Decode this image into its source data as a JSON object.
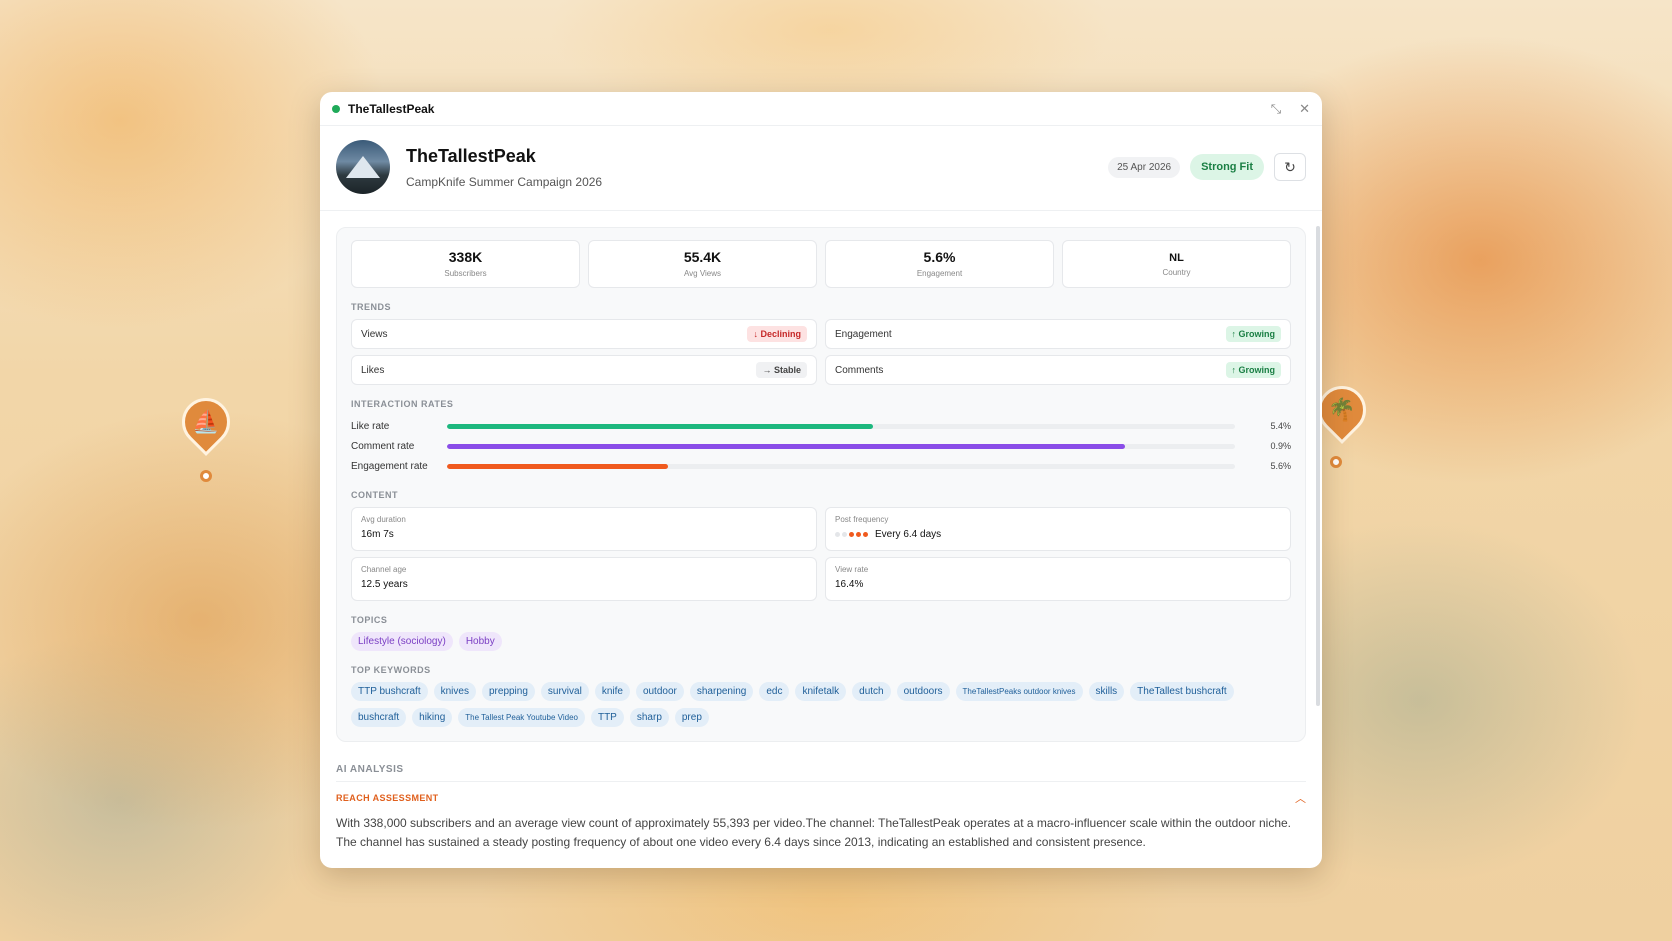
{
  "window": {
    "title": "TheTallestPeak"
  },
  "header": {
    "name": "TheTallestPeak",
    "campaign": "CampKnife Summer Campaign 2026",
    "date": "25 Apr 2026",
    "fit": "Strong Fit"
  },
  "stats": [
    {
      "value": "338K",
      "label": "Subscribers"
    },
    {
      "value": "55.4K",
      "label": "Avg Views"
    },
    {
      "value": "5.6%",
      "label": "Engagement"
    },
    {
      "value": "NL",
      "label": "Country"
    }
  ],
  "trends": {
    "label": "TRENDS",
    "items": [
      {
        "name": "Views",
        "status": "↓ Declining",
        "kind": "decl"
      },
      {
        "name": "Engagement",
        "status": "↑ Growing",
        "kind": "grow"
      },
      {
        "name": "Likes",
        "status": "→ Stable",
        "kind": "stable"
      },
      {
        "name": "Comments",
        "status": "↑ Growing",
        "kind": "grow"
      }
    ]
  },
  "rates": {
    "label": "INTERACTION RATES",
    "items": [
      {
        "name": "Like rate",
        "value": "5.4%",
        "fill": 0.54,
        "color": "#1db87e"
      },
      {
        "name": "Comment rate",
        "value": "0.9%",
        "fill": 0.86,
        "color": "#8a4de8"
      },
      {
        "name": "Engagement rate",
        "value": "5.6%",
        "fill": 0.28,
        "color": "#f05a1e"
      }
    ]
  },
  "content": {
    "label": "CONTENT",
    "avg_duration_label": "Avg duration",
    "avg_duration": "16m 7s",
    "post_freq_label": "Post frequency",
    "post_freq": "Every 6.4 days",
    "post_freq_dots": 3,
    "post_freq_dots_total": 5,
    "channel_age_label": "Channel age",
    "channel_age": "12.5 years",
    "view_rate_label": "View rate",
    "view_rate": "16.4%"
  },
  "topics": {
    "label": "TOPICS",
    "items": [
      "Lifestyle (sociology)",
      "Hobby"
    ]
  },
  "keywords": {
    "label": "TOP KEYWORDS",
    "items": [
      "TTP bushcraft",
      "knives",
      "prepping",
      "survival",
      "knife",
      "outdoor",
      "sharpening",
      "edc",
      "knifetalk",
      "dutch",
      "outdoors",
      "TheTallestPeaks outdoor knives",
      "skills",
      "TheTallest bushcraft",
      "bushcraft",
      "hiking",
      "The Tallest Peak Youtube Video",
      "TTP",
      "sharp",
      "prep"
    ]
  },
  "ai": {
    "label": "AI ANALYSIS",
    "section": "REACH ASSESSMENT",
    "text": "With 338,000 subscribers and an average view count of approximately 55,393 per video.The channel: TheTallestPeak operates at a macro-influencer scale within the outdoor niche. The channel has sustained a steady posting frequency of about one video every 6.4 days since 2013, indicating an established and consistent presence."
  }
}
